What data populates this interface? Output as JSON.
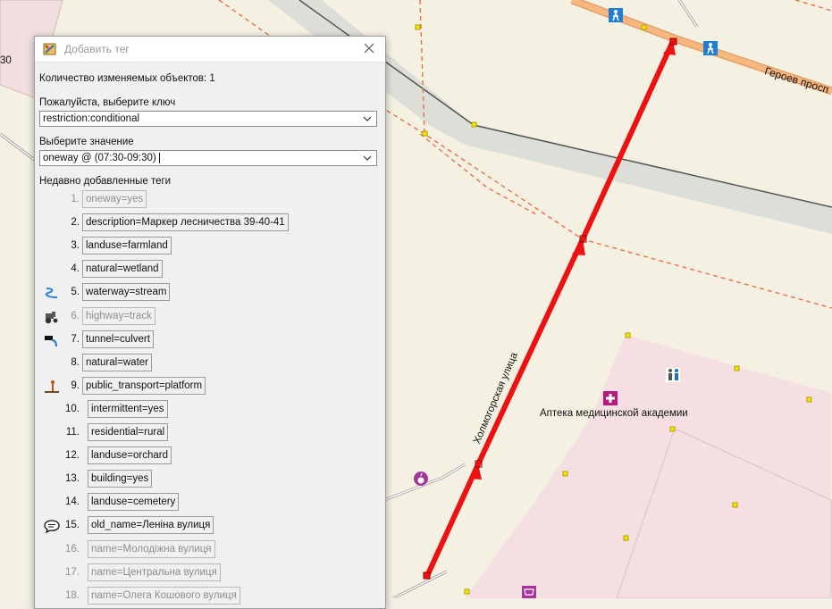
{
  "dialog": {
    "title": "Добавить тег",
    "objects_count_label": "Количество изменяемых объектов: 1",
    "key_label": "Пожалуйста, выберите ключ",
    "key_value": "restriction:conditional",
    "value_label": "Выберите значение",
    "value_value": "oneway @ (07:30-09:30)",
    "recent_label": "Недавно добавленные теги",
    "recent_tags": [
      {
        "num": "1.",
        "tag": "oneway=yes",
        "disabled": true,
        "icon": ""
      },
      {
        "num": "2.",
        "tag": "description=Маркер лесничества 39-40-41",
        "disabled": false,
        "icon": ""
      },
      {
        "num": "3.",
        "tag": "landuse=farmland",
        "disabled": false,
        "icon": ""
      },
      {
        "num": "4.",
        "tag": "natural=wetland",
        "disabled": false,
        "icon": ""
      },
      {
        "num": "5.",
        "tag": "waterway=stream",
        "disabled": false,
        "icon": "stream-icon"
      },
      {
        "num": "6.",
        "tag": "highway=track",
        "disabled": true,
        "icon": "tractor-icon"
      },
      {
        "num": "7.",
        "tag": "tunnel=culvert",
        "disabled": false,
        "icon": "culvert-icon"
      },
      {
        "num": "8.",
        "tag": "natural=water",
        "disabled": false,
        "icon": ""
      },
      {
        "num": "9.",
        "tag": "public_transport=platform",
        "disabled": false,
        "icon": "platform-icon"
      },
      {
        "num": "10.",
        "tag": "intermittent=yes",
        "disabled": false,
        "icon": ""
      },
      {
        "num": "11.",
        "tag": "residential=rural",
        "disabled": false,
        "icon": ""
      },
      {
        "num": "12.",
        "tag": "landuse=orchard",
        "disabled": false,
        "icon": ""
      },
      {
        "num": "13.",
        "tag": "building=yes",
        "disabled": false,
        "icon": ""
      },
      {
        "num": "14.",
        "tag": "landuse=cemetery",
        "disabled": false,
        "icon": ""
      },
      {
        "num": "15.",
        "tag": "old_name=Леніна вулиця",
        "disabled": false,
        "icon": "speech-bubble-icon"
      },
      {
        "num": "16.",
        "tag": "name=Молодіжна вулиця",
        "disabled": true,
        "icon": ""
      },
      {
        "num": "17.",
        "tag": "name=Центральна вулиця",
        "disabled": true,
        "icon": ""
      },
      {
        "num": "18.",
        "tag": "name=Олега Кошового вулиця",
        "disabled": true,
        "icon": ""
      }
    ]
  },
  "map": {
    "street_label": "Холмогорская улица",
    "road_label": "Героев просп",
    "pharmacy_label": "Аптека медицинской академии",
    "edge_label": "30",
    "icons": [
      "pedestrian-crossing-icon",
      "pharmacy-icon",
      "toilets-icon",
      "grocery-icon",
      "shop-icon"
    ]
  }
}
